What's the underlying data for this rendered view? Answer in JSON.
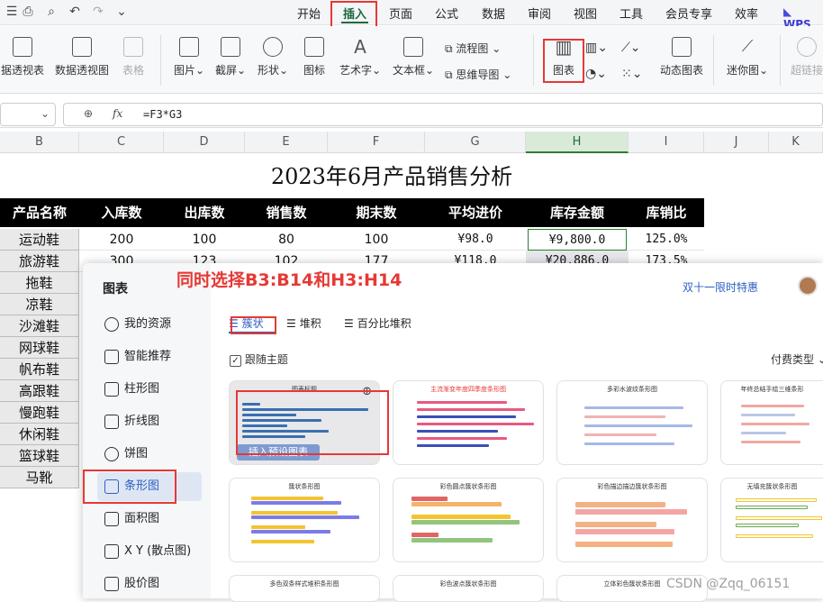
{
  "topbar": {
    "quick_icons": [
      "menu-icon",
      "print-icon",
      "print-preview-icon",
      "undo-icon",
      "redo-icon",
      "chevron-down-icon"
    ],
    "menus": [
      "开始",
      "插入",
      "页面",
      "公式",
      "数据",
      "审阅",
      "视图",
      "工具",
      "会员专享",
      "效率"
    ],
    "active_menu": "插入",
    "brand": "WPS"
  },
  "ribbon": {
    "items": [
      "据透视表",
      "数据透视图",
      "表格",
      "图片",
      "截屏",
      "形状",
      "图标",
      "艺术字",
      "文本框",
      "流程图",
      "思维导图",
      "图表",
      "动态图表",
      "迷你图",
      "超链接"
    ],
    "highlighted": "图表"
  },
  "formula": {
    "fx": "fx",
    "value": "=F3*G3"
  },
  "columns": [
    "B",
    "C",
    "D",
    "E",
    "F",
    "G",
    "H",
    "I",
    "J",
    "K"
  ],
  "selected_column": "H",
  "sheet": {
    "title": "2023年6月产品销售分析",
    "headers": [
      "产品名称",
      "入库数",
      "出库数",
      "销售数",
      "期末数",
      "平均进价",
      "库存金额",
      "库销比"
    ],
    "row1": [
      "运动鞋",
      "200",
      "100",
      "80",
      "100",
      "¥98.0",
      "¥9,800.0",
      "125.0%"
    ],
    "row2": [
      "旅游鞋",
      "300",
      "123",
      "102",
      "177",
      "¥118.0",
      "¥20,886.0",
      "173.5%"
    ],
    "products": [
      "运动鞋",
      "旅游鞋",
      "拖鞋",
      "凉鞋",
      "沙滩鞋",
      "网球鞋",
      "帆布鞋",
      "高跟鞋",
      "慢跑鞋",
      "休闲鞋",
      "篮球鞋",
      "马靴"
    ]
  },
  "dialog": {
    "title": "图表",
    "annotation": "同时选择B3:B14和H3:H14",
    "promo": "双十一限时特惠",
    "nav": [
      "我的资源",
      "智能推荐",
      "柱形图",
      "折线图",
      "饼图",
      "条形图",
      "面积图",
      "X Y (散点图)",
      "股价图"
    ],
    "active_nav": "条形图",
    "subtabs": [
      "簇状",
      "堆积",
      "百分比堆积"
    ],
    "active_subtab": "簇状",
    "follow_theme": "跟随主题",
    "fee_type": "付费类型",
    "templates": [
      {
        "title": "图表标题",
        "action": "插入预设图表"
      },
      {
        "title": "主流渐变年度四季度条形图"
      },
      {
        "title": "多彩水波纹条形图"
      },
      {
        "title": "年终总结手绘三维条形"
      },
      {
        "title": "簇状条形图"
      },
      {
        "title": "彩色圆点簇状条形图"
      },
      {
        "title": "彩色描边描边簇状条形图"
      },
      {
        "title": "无填充簇状条形图"
      },
      {
        "title": "多色双条样式堆积条形图"
      },
      {
        "title": "彩色波点簇状条形图"
      },
      {
        "title": "立体彩色簇状条形图"
      }
    ]
  },
  "watermark": "CSDN @Zqq_06151",
  "colors": {
    "accent_green": "#1d6b3e",
    "annotation_red": "#e53935",
    "blue": "#2d5fc4"
  }
}
